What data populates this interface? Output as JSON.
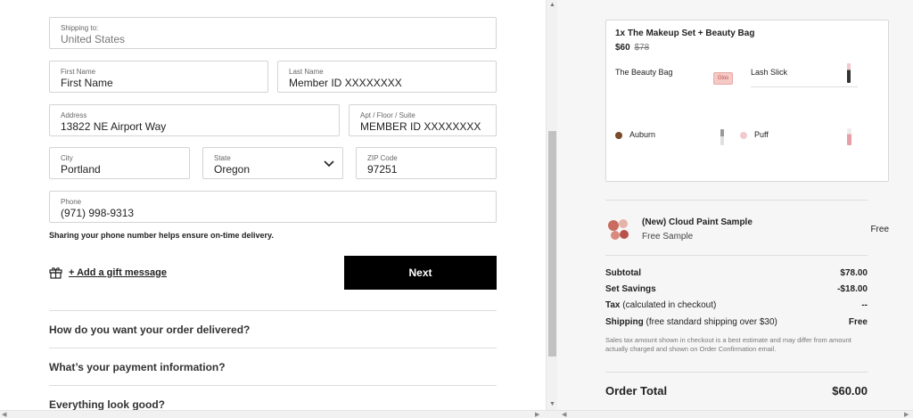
{
  "form": {
    "shipping_to": {
      "label": "Shipping to:",
      "value": "United States"
    },
    "first_name": {
      "label": "First Name",
      "value": "First Name"
    },
    "last_name": {
      "label": "Last Name",
      "value": "Member ID XXXXXXXX"
    },
    "address": {
      "label": "Address",
      "value": "13822 NE Airport Way"
    },
    "apt": {
      "label": "Apt / Floor / Suite",
      "value": "MEMBER ID XXXXXXXX"
    },
    "city": {
      "label": "City",
      "value": "Portland"
    },
    "state": {
      "label": "State",
      "value": "Oregon"
    },
    "zip": {
      "label": "ZIP Code",
      "value": "97251"
    },
    "phone": {
      "label": "Phone",
      "value": "(971) 998-9313"
    },
    "phone_note": "Sharing your phone number helps ensure on-time delivery.",
    "gift_message": "+ Add a gift message",
    "next_label": "Next"
  },
  "sections": [
    "How do you want your order delivered?",
    "What’s your payment information?",
    "Everything look good?"
  ],
  "summary": {
    "product_title": "1x The Makeup Set + Beauty Bag",
    "price": "$60",
    "original_price": "$78",
    "items": [
      {
        "name": "The Beauty Bag"
      },
      {
        "name": "Lash Slick"
      },
      {
        "name": "Auburn",
        "swatch": "#7a4a2a"
      },
      {
        "name": "Puff",
        "swatch": "#f2c9cf"
      }
    ],
    "bag_label": "Glos",
    "sample": {
      "name": "(New) Cloud Paint Sample",
      "sub": "Free Sample",
      "price": "Free"
    },
    "rows": [
      {
        "label": "Subtotal",
        "extra": "",
        "value": "$78.00"
      },
      {
        "label": "Set Savings",
        "extra": "",
        "value": "-$18.00"
      },
      {
        "label": "Tax",
        "extra": " (calculated in checkout)",
        "value": "--"
      },
      {
        "label": "Shipping",
        "extra": " (free standard shipping over $30)",
        "value": "Free"
      }
    ],
    "disclaimer": "Sales tax amount shown in checkout is a best estimate and may differ from amount actually charged and shown on Order Confirmation email.",
    "total_label": "Order Total",
    "total_value": "$60.00"
  }
}
